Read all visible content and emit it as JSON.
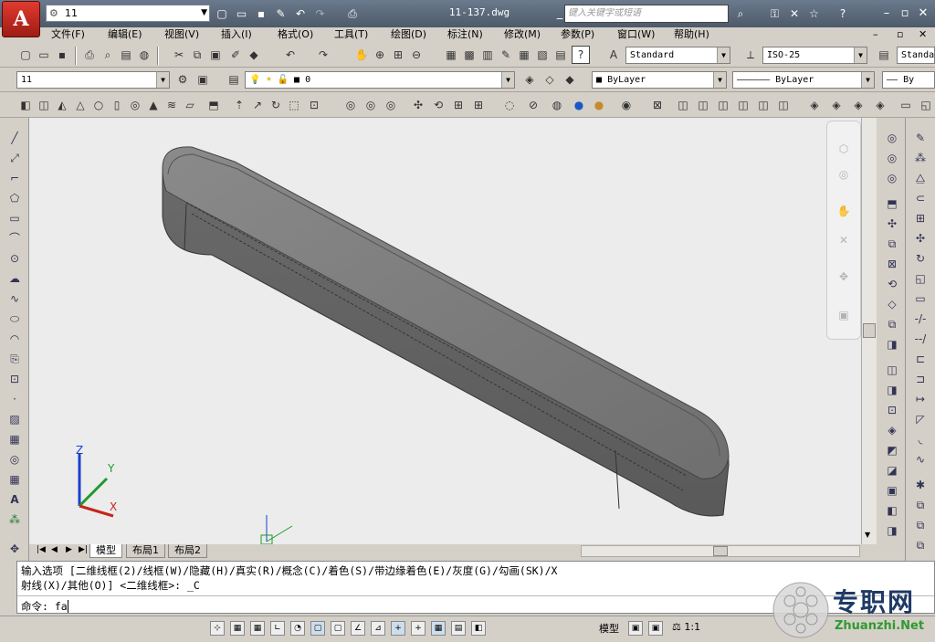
{
  "app": {
    "logo_letter": "A",
    "workspace_name": "11",
    "document_title": "11-137.dwg",
    "search_placeholder": "键入关键字或短语"
  },
  "menu": [
    "文件(F)",
    "编辑(E)",
    "视图(V)",
    "插入(I)",
    "格式(O)",
    "工具(T)",
    "绘图(D)",
    "标注(N)",
    "修改(M)",
    "参数(P)",
    "窗口(W)",
    "帮助(H)"
  ],
  "toolbars": {
    "text_style": "Standard",
    "dim_style": "ISO-25",
    "table_style": "Standa",
    "view_name": "11",
    "layer_name": "0",
    "color": "ByLayer",
    "linetype": "ByLayer",
    "lineweight": "By"
  },
  "layout_tabs": [
    "模型",
    "布局1",
    "布局2"
  ],
  "command": {
    "line1": "输入选项 [二维线框(2)/线框(W)/隐藏(H)/真实(R)/概念(C)/着色(S)/带边缘着色(E)/灰度(G)/勾画(SK)/X",
    "line2": "射线(X)/其他(O)] <二维线框>: _C",
    "prompt": "命令: fa"
  },
  "status": {
    "model_label": "模型",
    "scale": "1:1"
  },
  "axes": {
    "x": "X",
    "y": "Y",
    "z": "Z"
  },
  "watermark": {
    "title": "专职网",
    "url": "Zhuanzhi.Net"
  },
  "colors": {
    "accent": "#c4261b",
    "object_fill": "#7a7a7a",
    "viewport_bg": "#ececec"
  }
}
